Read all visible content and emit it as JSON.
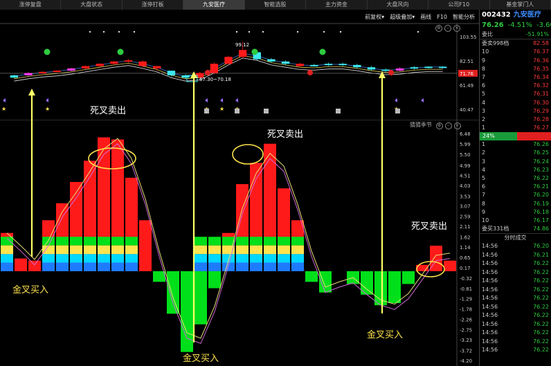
{
  "tabs": [
    "涨停复盘",
    "大盘状态",
    "涨停打板",
    "九安医疗",
    "智能选股",
    "主力资金",
    "大盘风向",
    "公司F10",
    "基金掌门人"
  ],
  "active_tab": 3,
  "toolbar": [
    "前复权▾",
    "超级叠加▾",
    "画线",
    "F10",
    "智能分析"
  ],
  "upper": {
    "scale": [
      "103.55",
      "82.51",
      "71.76",
      "61.49",
      "40.47"
    ],
    "labels": {
      "high": "99.12",
      "range": "67.30~70.18"
    },
    "candles": [
      {
        "o": 68,
        "c": 70,
        "h": 70.5,
        "l": 67.5,
        "color": "cyan"
      },
      {
        "o": 70,
        "c": 72,
        "h": 72.5,
        "l": 69.5,
        "color": "magenta"
      },
      {
        "o": 72,
        "c": 73,
        "h": 73.5,
        "l": 71.5,
        "color": "red"
      },
      {
        "o": 73,
        "c": 74,
        "h": 74.5,
        "l": 72.5,
        "color": "red"
      },
      {
        "o": 74,
        "c": 76,
        "h": 76.5,
        "l": 73.5,
        "color": "magenta"
      },
      {
        "o": 76,
        "c": 78,
        "h": 78.5,
        "l": 75,
        "color": "red"
      },
      {
        "o": 78,
        "c": 80,
        "h": 80.5,
        "l": 77,
        "color": "red"
      },
      {
        "o": 80,
        "c": 82,
        "h": 82.5,
        "l": 79,
        "color": "red"
      },
      {
        "o": 82,
        "c": 83,
        "h": 84,
        "l": 81,
        "color": "red"
      },
      {
        "o": 82,
        "c": 78,
        "h": 83,
        "l": 77,
        "color": "red"
      },
      {
        "o": 78,
        "c": 76,
        "h": 78,
        "l": 74,
        "color": "red"
      },
      {
        "o": 74,
        "c": 70,
        "h": 74,
        "l": 69,
        "color": "cyan"
      },
      {
        "o": 70,
        "c": 68,
        "h": 71,
        "l": 67.3,
        "color": "cyan"
      },
      {
        "o": 68,
        "c": 72,
        "h": 73,
        "l": 67.5,
        "color": "red"
      },
      {
        "o": 72,
        "c": 80,
        "h": 81,
        "l": 71,
        "color": "red"
      },
      {
        "o": 80,
        "c": 86,
        "h": 87,
        "l": 79,
        "color": "red"
      },
      {
        "o": 86,
        "c": 92,
        "h": 99.12,
        "l": 85,
        "color": "red"
      },
      {
        "o": 90,
        "c": 84,
        "h": 91,
        "l": 83,
        "color": "cyan"
      },
      {
        "o": 84,
        "c": 82,
        "h": 85,
        "l": 81,
        "color": "cyan"
      },
      {
        "o": 82,
        "c": 80,
        "h": 83,
        "l": 79,
        "color": "cyan"
      },
      {
        "o": 80,
        "c": 78,
        "h": 81,
        "l": 77,
        "color": "red"
      },
      {
        "o": 78,
        "c": 79,
        "h": 80,
        "l": 77.5,
        "color": "cyan"
      },
      {
        "o": 79,
        "c": 80,
        "h": 81,
        "l": 78,
        "color": "cyan"
      },
      {
        "o": 80,
        "c": 79,
        "h": 81,
        "l": 78,
        "color": "cyan"
      },
      {
        "o": 79,
        "c": 77,
        "h": 80,
        "l": 76,
        "color": "cyan"
      },
      {
        "o": 77,
        "c": 75,
        "h": 78,
        "l": 74,
        "color": "cyan"
      },
      {
        "o": 75,
        "c": 74,
        "h": 76,
        "l": 73,
        "color": "cyan"
      },
      {
        "o": 74,
        "c": 76,
        "h": 77,
        "l": 73.5,
        "color": "magenta"
      },
      {
        "o": 76,
        "c": 77,
        "h": 78,
        "l": 75,
        "color": "cyan"
      },
      {
        "o": 77,
        "c": 77.5,
        "h": 78,
        "l": 76,
        "color": "cyan"
      },
      {
        "o": 77,
        "c": 77.5,
        "h": 78,
        "l": 76,
        "color": "cyan"
      }
    ]
  },
  "lower": {
    "title": "猜猜季节",
    "scale": [
      "6.48",
      "5.99",
      "5.50",
      "4.99",
      "4.51",
      "4.03",
      "3.53",
      "3.07",
      "2.59",
      "2.11",
      "1.62",
      "1.14",
      "0.65",
      "0.17",
      "-0.32",
      "-0.81",
      "-1.29",
      "-1.78",
      "-2.26",
      "-2.75",
      "-3.23",
      "-3.72",
      "-4.20"
    ],
    "ymin": -4.2,
    "ymax": 6.48,
    "bars": [
      1.8,
      0.6,
      0.5,
      2.4,
      3.2,
      4.2,
      5.2,
      6.3,
      6.2,
      4.4,
      2.4,
      -0.5,
      -2.0,
      -3.8,
      -2.5,
      -0.8,
      1.8,
      4.1,
      5.1,
      6.0,
      3.9,
      2.4,
      -0.5,
      -1.0,
      0.0,
      -0.6,
      -1.1,
      -1.6,
      -1.5,
      -0.6,
      0.3,
      1.2,
      0.5
    ]
  },
  "annotations": {
    "golden_cross_buy": "金叉买入",
    "death_cross_sell": "死叉卖出"
  },
  "side": {
    "code": "002432",
    "name": "九安医疗",
    "price": "76.26",
    "change_pct": "-4.51%",
    "change": "-3.60",
    "weibi_label": "委比",
    "weibi": "-51.91%",
    "sell_title": "委卖998档",
    "sell_title_price": "82.58",
    "sell": [
      {
        "l": "10",
        "v": "76.37"
      },
      {
        "l": "9",
        "v": "76.36"
      },
      {
        "l": "8",
        "v": "76.35"
      },
      {
        "l": "7",
        "v": "76.34"
      },
      {
        "l": "6",
        "v": "76.32"
      },
      {
        "l": "5",
        "v": "76.31"
      },
      {
        "l": "4",
        "v": "76.30"
      },
      {
        "l": "3",
        "v": "76.29"
      },
      {
        "l": "2",
        "v": "76.28"
      },
      {
        "l": "1",
        "v": "76.27"
      }
    ],
    "pct24": "24%",
    "buy": [
      {
        "l": "1",
        "v": "76.26"
      },
      {
        "l": "2",
        "v": "76.25"
      },
      {
        "l": "3",
        "v": "76.24"
      },
      {
        "l": "4",
        "v": "76.23"
      },
      {
        "l": "5",
        "v": "76.22"
      },
      {
        "l": "6",
        "v": "76.21"
      },
      {
        "l": "7",
        "v": "76.20"
      },
      {
        "l": "8",
        "v": "76.19"
      },
      {
        "l": "9",
        "v": "76.18"
      },
      {
        "l": "10",
        "v": "76.17"
      }
    ],
    "buy_title": "委买331档",
    "buy_title_price": "74.86",
    "trades_title": "分时成交",
    "trades": [
      {
        "t": "14:56",
        "p": "76.20"
      },
      {
        "t": "14:56",
        "p": "76.21"
      },
      {
        "t": "14:56",
        "p": "76.22"
      },
      {
        "t": "14:56",
        "p": "76.22"
      },
      {
        "t": "14:56",
        "p": "76.22"
      },
      {
        "t": "14:56",
        "p": "76.22"
      },
      {
        "t": "14:56",
        "p": "76.22"
      },
      {
        "t": "14:56",
        "p": "76.22"
      },
      {
        "t": "14:56",
        "p": "76.22"
      },
      {
        "t": "14:56",
        "p": "76.22"
      },
      {
        "t": "14:56",
        "p": "76.22"
      },
      {
        "t": "14:56",
        "p": "76.22"
      },
      {
        "t": "14:56",
        "p": "76.22"
      }
    ]
  },
  "colors": {
    "red": "#ff1a1a",
    "green": "#00e01a",
    "yellow": "#ffe44d",
    "cyan": "#00d8ff",
    "blue": "#1e7bff",
    "cyan_candle": "#3ee8f0",
    "magenta": "#ff3cf0",
    "arrow": "#ffff66"
  }
}
